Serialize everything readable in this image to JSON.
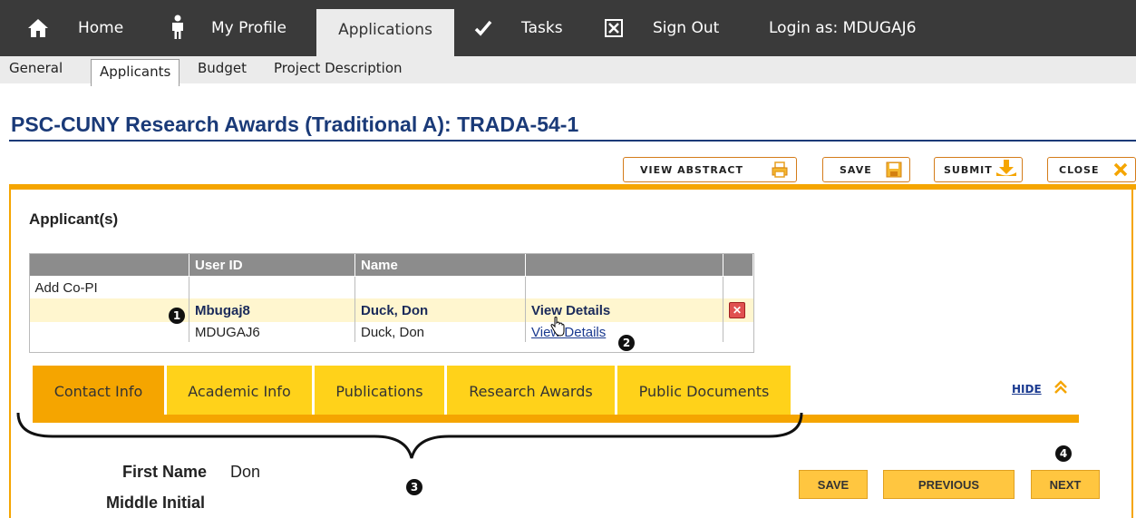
{
  "nav": {
    "home": "Home",
    "profile": "My Profile",
    "applications": "Applications",
    "tasks": "Tasks",
    "signout": "Sign Out",
    "login": "Login as: MDUGAJ6"
  },
  "subnav": [
    "General",
    "Applicants",
    "Budget",
    "Project Description"
  ],
  "title": "PSC-CUNY Research Awards (Traditional A): TRADA-54-1",
  "toolbar": {
    "view_abstract": "VIEW ABSTRACT",
    "save": "SAVE",
    "submit": "SUBMIT",
    "close": "CLOSE"
  },
  "section": "Applicant(s)",
  "table": {
    "headers": [
      "",
      "User ID",
      "Name",
      ""
    ],
    "add_label": "Add Co-PI",
    "rows": [
      {
        "user_id": "Mbugaj8",
        "name": "Duck, Don",
        "link": "View Details"
      },
      {
        "user_id": "MDUGAJ6",
        "name": "Duck, Don",
        "link": "View Details"
      }
    ]
  },
  "markers": [
    "1",
    "2",
    "3",
    "4"
  ],
  "tabs": [
    "Contact Info",
    "Academic Info",
    "Publications",
    "Research Awards",
    "Public Documents"
  ],
  "hide": "HIDE",
  "form": {
    "first_name_label": "First Name",
    "first_name_value": "Don",
    "middle_initial_label": "Middle Initial"
  },
  "buttons": {
    "save": "SAVE",
    "previous": "PREVIOUS",
    "next": "NEXT"
  },
  "colors": {
    "accent": "#f5a500",
    "tab": "#ffd21a",
    "title": "#1a3a78",
    "nav": "#3a3a3a"
  }
}
